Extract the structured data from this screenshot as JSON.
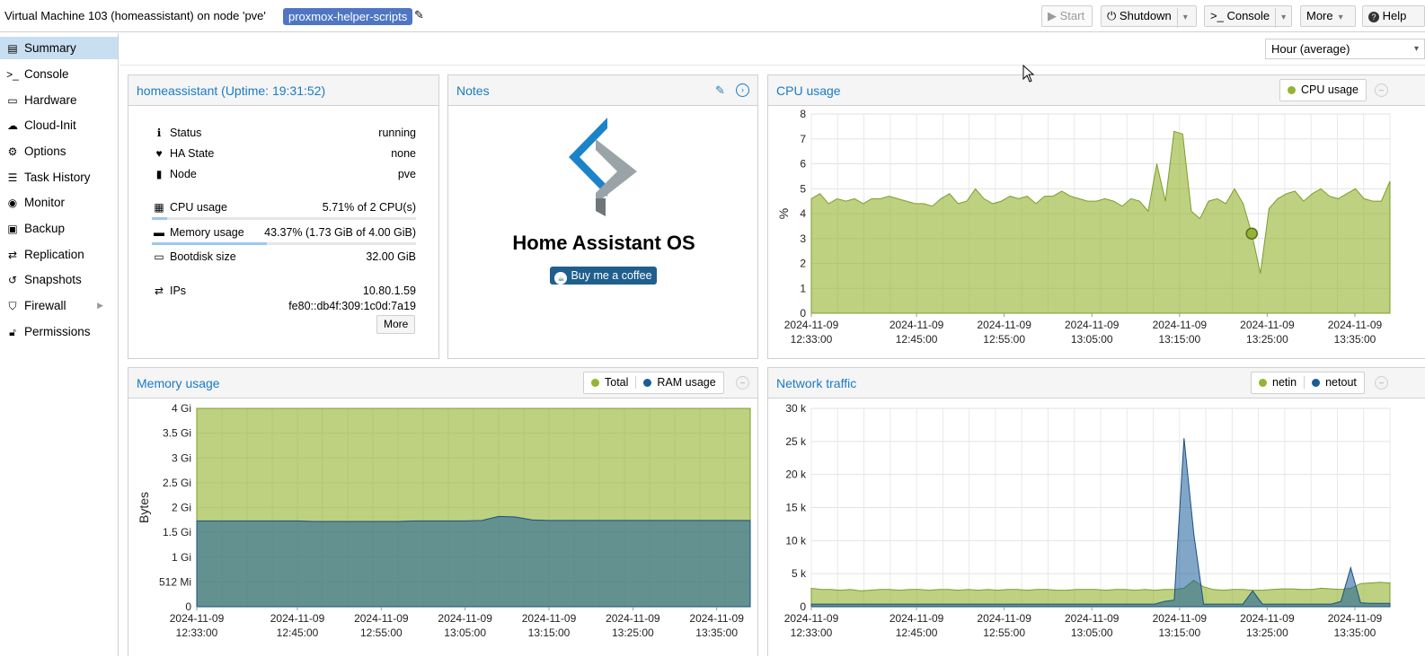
{
  "window": {
    "title": "Virtual Machine 103 (homeassistant) on node 'pve'",
    "tag": "proxmox-helper-scripts"
  },
  "toolbar": {
    "start": "Start",
    "shutdown": "Shutdown",
    "console": "Console",
    "more": "More",
    "help": "Help",
    "timeframe": "Hour (average)"
  },
  "sidebar": {
    "items": [
      {
        "label": "Summary",
        "icon": "book-icon"
      },
      {
        "label": "Console",
        "icon": "terminal-icon"
      },
      {
        "label": "Hardware",
        "icon": "monitor-icon"
      },
      {
        "label": "Cloud-Init",
        "icon": "cloud-icon"
      },
      {
        "label": "Options",
        "icon": "gear-icon"
      },
      {
        "label": "Task History",
        "icon": "list-icon"
      },
      {
        "label": "Monitor",
        "icon": "eye-icon"
      },
      {
        "label": "Backup",
        "icon": "floppy-icon"
      },
      {
        "label": "Replication",
        "icon": "retweet-icon"
      },
      {
        "label": "Snapshots",
        "icon": "history-icon"
      },
      {
        "label": "Firewall",
        "icon": "shield-icon"
      },
      {
        "label": "Permissions",
        "icon": "unlock-icon"
      }
    ]
  },
  "status_panel": {
    "title": "homeassistant (Uptime: 19:31:52)",
    "rows": {
      "status": {
        "label": "Status",
        "value": "running"
      },
      "ha_state": {
        "label": "HA State",
        "value": "none"
      },
      "node": {
        "label": "Node",
        "value": "pve"
      },
      "cpu": {
        "label": "CPU usage",
        "value": "5.71% of 2 CPU(s)",
        "fraction": 0.0571
      },
      "memory": {
        "label": "Memory usage",
        "value": "43.37% (1.73 GiB of 4.00 GiB)",
        "fraction": 0.4337
      },
      "bootdisk": {
        "label": "Bootdisk size",
        "value": "32.00 GiB"
      },
      "ips": {
        "label": "IPs",
        "ipv4": "10.80.1.59",
        "ipv6": "fe80::db4f:309:1c0d:7a19"
      }
    },
    "more_label": "More"
  },
  "notes_panel": {
    "title": "Notes",
    "heading": "Home Assistant OS",
    "coffee_label": "Buy me a coffee"
  },
  "chart_data": [
    {
      "id": "cpu",
      "type": "area",
      "title": "CPU usage",
      "ylabel": "%",
      "ylim": [
        0,
        8
      ],
      "yticks": [
        0,
        1,
        2,
        3,
        4,
        5,
        6,
        7,
        8
      ],
      "grid": true,
      "legend_position": "top-right",
      "x_tick_labels": [
        [
          "2024-11-09",
          "12:33:00"
        ],
        [
          "2024-11-09",
          "12:45:00"
        ],
        [
          "2024-11-09",
          "12:55:00"
        ],
        [
          "2024-11-09",
          "13:05:00"
        ],
        [
          "2024-11-09",
          "13:15:00"
        ],
        [
          "2024-11-09",
          "13:25:00"
        ],
        [
          "2024-11-09",
          "13:35:00"
        ]
      ],
      "x_minutes_range": [
        0,
        66
      ],
      "x_tick_minutes": [
        0,
        12,
        22,
        32,
        42,
        52,
        62
      ],
      "series": [
        {
          "name": "CPU usage",
          "color": "#94b533",
          "values": [
            4.6,
            4.8,
            4.4,
            4.6,
            4.5,
            4.6,
            4.4,
            4.6,
            4.6,
            4.7,
            4.6,
            4.5,
            4.4,
            4.4,
            4.3,
            4.6,
            4.8,
            4.4,
            4.5,
            5.0,
            4.6,
            4.4,
            4.5,
            4.7,
            4.6,
            4.7,
            4.4,
            4.7,
            4.7,
            4.9,
            4.7,
            4.6,
            4.5,
            4.5,
            4.6,
            4.5,
            4.3,
            4.6,
            4.5,
            4.1,
            6.0,
            4.5,
            7.3,
            7.2,
            4.1,
            3.8,
            4.5,
            4.6,
            4.4,
            5.0,
            4.4,
            3.2,
            1.6,
            4.2,
            4.6,
            4.8,
            4.9,
            4.5,
            4.8,
            5.0,
            4.7,
            4.6,
            4.8,
            5.0,
            4.6,
            4.5,
            4.5,
            5.3
          ]
        }
      ],
      "highlight": {
        "index": 51,
        "value": 3.2
      }
    },
    {
      "id": "memory",
      "type": "area",
      "title": "Memory usage",
      "ylabel": "Bytes",
      "ylim_gib": [
        0,
        4
      ],
      "yticks": [
        {
          "gib": 0,
          "label": "0"
        },
        {
          "gib": 0.5,
          "label": "512 Mi"
        },
        {
          "gib": 1,
          "label": "1 Gi"
        },
        {
          "gib": 1.5,
          "label": "1.5 Gi"
        },
        {
          "gib": 2,
          "label": "2 Gi"
        },
        {
          "gib": 2.5,
          "label": "2.5 Gi"
        },
        {
          "gib": 3,
          "label": "3 Gi"
        },
        {
          "gib": 3.5,
          "label": "3.5 Gi"
        },
        {
          "gib": 4,
          "label": "4 Gi"
        }
      ],
      "grid": true,
      "legend_position": "top-right",
      "x_tick_labels": [
        [
          "2024-11-09",
          "12:33:00"
        ],
        [
          "2024-11-09",
          "12:45:00"
        ],
        [
          "2024-11-09",
          "12:55:00"
        ],
        [
          "2024-11-09",
          "13:05:00"
        ],
        [
          "2024-11-09",
          "13:15:00"
        ],
        [
          "2024-11-09",
          "13:25:00"
        ],
        [
          "2024-11-09",
          "13:35:00"
        ]
      ],
      "x_minutes_range": [
        0,
        66
      ],
      "x_tick_minutes": [
        0,
        12,
        22,
        32,
        42,
        52,
        62
      ],
      "series": [
        {
          "name": "Total",
          "color": "#94b533",
          "values_gib": [
            4.0,
            4.0
          ]
        },
        {
          "name": "RAM usage",
          "color": "#1a5c9a",
          "values_gib": [
            1.73,
            1.73,
            1.73,
            1.73,
            1.73,
            1.73,
            1.73,
            1.72,
            1.72,
            1.72,
            1.72,
            1.72,
            1.72,
            1.73,
            1.73,
            1.73,
            1.73,
            1.74,
            1.82,
            1.81,
            1.75,
            1.74,
            1.74,
            1.74,
            1.74,
            1.74,
            1.74,
            1.74,
            1.74,
            1.74,
            1.74,
            1.74,
            1.74,
            1.74
          ]
        }
      ]
    },
    {
      "id": "network",
      "type": "area",
      "title": "Network traffic",
      "ylim": [
        0,
        30000
      ],
      "yticks": [
        {
          "v": 0,
          "label": "0"
        },
        {
          "v": 5000,
          "label": "5 k"
        },
        {
          "v": 10000,
          "label": "10 k"
        },
        {
          "v": 15000,
          "label": "15 k"
        },
        {
          "v": 20000,
          "label": "20 k"
        },
        {
          "v": 25000,
          "label": "25 k"
        },
        {
          "v": 30000,
          "label": "30 k"
        }
      ],
      "grid": true,
      "legend_position": "top-right",
      "x_tick_labels": [
        [
          "2024-11-09",
          "12:33:00"
        ],
        [
          "2024-11-09",
          "12:45:00"
        ],
        [
          "2024-11-09",
          "12:55:00"
        ],
        [
          "2024-11-09",
          "13:05:00"
        ],
        [
          "2024-11-09",
          "13:15:00"
        ],
        [
          "2024-11-09",
          "13:25:00"
        ],
        [
          "2024-11-09",
          "13:35:00"
        ]
      ],
      "x_minutes_range": [
        0,
        66
      ],
      "x_tick_minutes": [
        0,
        12,
        22,
        32,
        42,
        52,
        62
      ],
      "series": [
        {
          "name": "netin",
          "color": "#94b533",
          "values": [
            2800,
            2600,
            2600,
            2500,
            2600,
            2400,
            2500,
            2600,
            2600,
            2500,
            2600,
            2600,
            2500,
            2600,
            2600,
            2500,
            2600,
            2500,
            2600,
            2500,
            2600,
            2600,
            2500,
            2600,
            2600,
            2500,
            2500,
            2600,
            2600,
            2600,
            2500,
            2600,
            2600,
            2500,
            2600,
            2500,
            2600,
            2600,
            2800,
            4000,
            3000,
            2600,
            2500,
            2600,
            2600,
            2500,
            2500,
            2600,
            2700,
            2700,
            2600,
            2600,
            2800,
            2700,
            2600,
            2800,
            3500,
            3600,
            3700,
            3600
          ]
        },
        {
          "name": "netout",
          "color": "#1a5c9a",
          "values": [
            400,
            400,
            400,
            400,
            400,
            400,
            400,
            400,
            400,
            400,
            400,
            400,
            400,
            400,
            400,
            400,
            400,
            400,
            400,
            400,
            400,
            400,
            400,
            400,
            400,
            400,
            400,
            400,
            400,
            400,
            400,
            400,
            400,
            400,
            400,
            400,
            800,
            1000,
            25500,
            11000,
            400,
            400,
            400,
            400,
            400,
            2400,
            400,
            400,
            400,
            400,
            400,
            400,
            400,
            400,
            800,
            5900,
            600,
            500,
            500,
            500
          ]
        }
      ]
    }
  ]
}
